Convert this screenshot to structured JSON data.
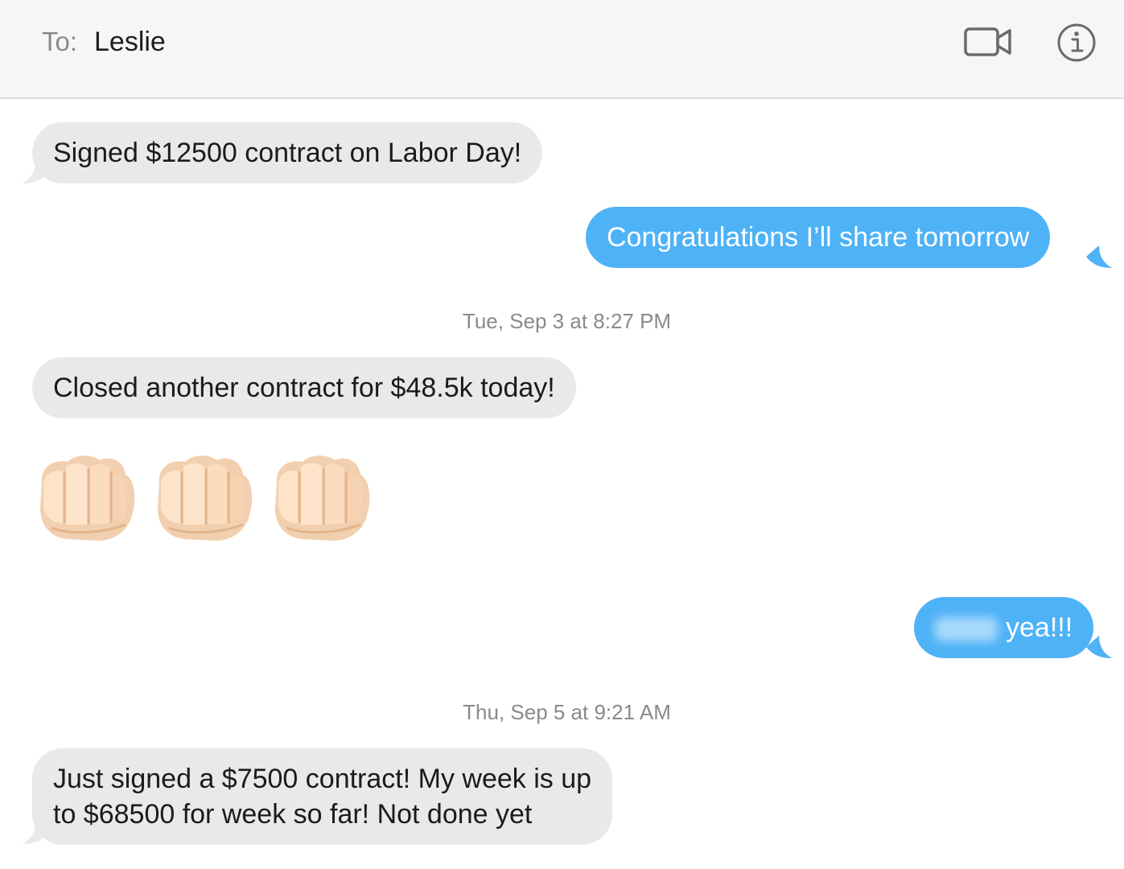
{
  "header": {
    "to_label": "To:",
    "recipient": "Leslie",
    "video_icon": "video-camera-icon",
    "info_icon": "info-icon"
  },
  "messages": [
    {
      "direction": "received",
      "text": "Signed $12500 contract on Labor Day!"
    },
    {
      "direction": "sent",
      "text": "Congratulations I’ll share tomorrow"
    },
    {
      "type": "timestamp",
      "text": "Tue, Sep 3 at 8:27 PM"
    },
    {
      "direction": "received",
      "text": "Closed another contract for $48.5k today!"
    },
    {
      "direction": "received",
      "type": "emoji",
      "text": "👊🏻👊🏻👊🏻",
      "icon": "fist-bump-emoji"
    },
    {
      "direction": "sent",
      "text": "yea!!!",
      "redacted_prefix": true
    },
    {
      "type": "timestamp",
      "text": "Thu, Sep 5 at 9:21 AM"
    },
    {
      "direction": "received",
      "lines": [
        "Just signed a $7500 contract! My week is up",
        "to $68500 for week so far!  Not done yet"
      ]
    }
  ],
  "colors": {
    "received_bubble": "#e9e9eb",
    "sent_bubble": "#4eb2f7",
    "header_bg": "#f6f6f6"
  }
}
